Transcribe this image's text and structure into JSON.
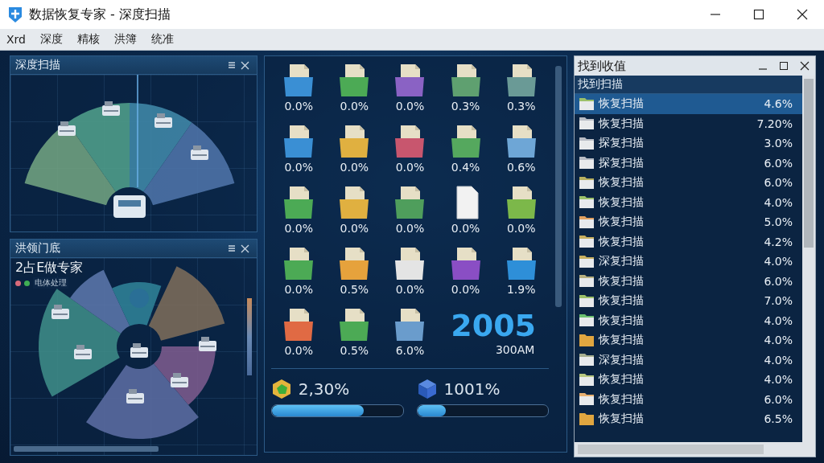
{
  "window": {
    "title": "数据恢复专家 - 深度扫描"
  },
  "menu": [
    "Xrd",
    "深度",
    "精核",
    "洪簿",
    "统准"
  ],
  "scan_panel": {
    "title": "深度扫描"
  },
  "summary_panel": {
    "title": "洪领门底",
    "heading": "2占E做专家",
    "legend_dots": [
      {
        "color": "#d86a7a"
      },
      {
        "color": "#3fae54"
      }
    ],
    "legend_label": "电体处理"
  },
  "file_types": [
    {
      "kind": "folder",
      "color": "#3a8fd4",
      "reading": "0.0%"
    },
    {
      "kind": "folder",
      "color": "#4caa55",
      "reading": "0.0%"
    },
    {
      "kind": "folder",
      "color": "#8a62c4",
      "reading": "0.0%"
    },
    {
      "kind": "folder",
      "color": "#5fa070",
      "reading": "0.3%"
    },
    {
      "kind": "folder",
      "color": "#6a9a96",
      "reading": "0.3%"
    },
    {
      "kind": "folder",
      "color": "#3a8fd4",
      "reading": "0.0%"
    },
    {
      "kind": "folder",
      "color": "#e0b040",
      "reading": "0.0%"
    },
    {
      "kind": "folder",
      "color": "#c8566e",
      "reading": "0.0%"
    },
    {
      "kind": "folder",
      "color": "#55a85e",
      "reading": "0.4%"
    },
    {
      "kind": "folder",
      "color": "#6ea6d6",
      "reading": "0.6%"
    },
    {
      "kind": "folder",
      "color": "#4caa55",
      "reading": "0.0%"
    },
    {
      "kind": "folder",
      "color": "#e0b040",
      "reading": "0.0%"
    },
    {
      "kind": "folder",
      "color": "#4f9e5c",
      "reading": "0.0%"
    },
    {
      "kind": "document",
      "color": "#f2f2f2",
      "reading": "0.0%"
    },
    {
      "kind": "folder",
      "color": "#7cb84a",
      "reading": "0.0%"
    },
    {
      "kind": "folder",
      "color": "#4caa55",
      "reading": "0.0%"
    },
    {
      "kind": "folder",
      "color": "#e6a23c",
      "reading": "0.5%"
    },
    {
      "kind": "folder",
      "color": "#e4e4e4",
      "reading": "0.0%"
    },
    {
      "kind": "folder",
      "color": "#8a4ec4",
      "reading": "0.0%"
    },
    {
      "kind": "folder",
      "color": "#2e8fd8",
      "reading": "1.9%"
    },
    {
      "kind": "folder",
      "color": "#e06a44",
      "reading": "0.0%"
    },
    {
      "kind": "folder",
      "color": "#4caa55",
      "reading": "0.5%"
    },
    {
      "kind": "folder",
      "color": "#6a9ccc",
      "reading": "6.0%"
    }
  ],
  "stat": {
    "value": "2005",
    "caption": "300AM"
  },
  "progress": [
    {
      "kind": "gem",
      "reading": "2,30%",
      "level": 0.7
    },
    {
      "kind": "cube",
      "reading": "1001%",
      "level": 0.22
    }
  ],
  "results": {
    "title": "找到收值",
    "header": "找到扫描",
    "rows": [
      {
        "name": "恢复扫描",
        "reading": "4.6%",
        "color": "#9cc06a",
        "selected": true
      },
      {
        "name": "恢复扫描",
        "reading": "7.20%",
        "color": "#b8bcc4",
        "selected": false
      },
      {
        "name": "探复扫描",
        "reading": "3.0%",
        "color": "#b8bcc4",
        "selected": false
      },
      {
        "name": "探复扫描",
        "reading": "6.0%",
        "color": "#b8bcc4",
        "selected": false
      },
      {
        "name": "恢复扫描",
        "reading": "6.0%",
        "color": "#b8b060",
        "selected": false
      },
      {
        "name": "恢复扫描",
        "reading": "4.0%",
        "color": "#9cc06a",
        "selected": false
      },
      {
        "name": "恢复扫描",
        "reading": "5.0%",
        "color": "#e0a060",
        "selected": false
      },
      {
        "name": "恢复扫描",
        "reading": "4.2%",
        "color": "#c8b060",
        "selected": false
      },
      {
        "name": "深复扫描",
        "reading": "4.0%",
        "color": "#c8b060",
        "selected": false
      },
      {
        "name": "恢复扫描",
        "reading": "6.0%",
        "color": "#b8b080",
        "selected": false
      },
      {
        "name": "恢复扫描",
        "reading": "7.0%",
        "color": "#9cc06a",
        "selected": false
      },
      {
        "name": "恢复扫描",
        "reading": "4.0%",
        "color": "#6cc070",
        "selected": false
      },
      {
        "name": "恢复扫描",
        "reading": "4.0%",
        "color": "#e0a640",
        "selected": false
      },
      {
        "name": "深复扫描",
        "reading": "4.0%",
        "color": "#a8b090",
        "selected": false
      },
      {
        "name": "恢复扫描",
        "reading": "4.0%",
        "color": "#b8c880",
        "selected": false
      },
      {
        "name": "恢复扫描",
        "reading": "6.0%",
        "color": "#e8b070",
        "selected": false
      },
      {
        "name": "恢复扫描",
        "reading": "6.5%",
        "color": "#e0a640",
        "selected": false
      }
    ]
  }
}
